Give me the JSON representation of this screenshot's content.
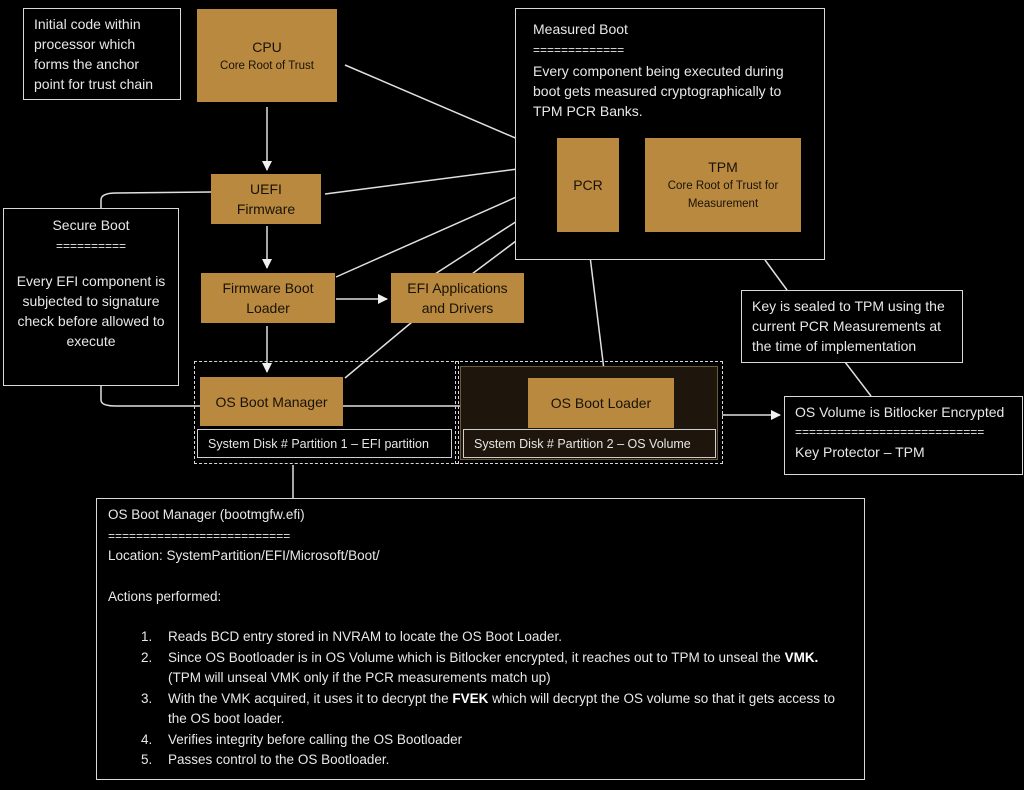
{
  "notes": {
    "cpu_note": "Initial code within processor which forms the anchor point for trust chain",
    "secure_boot": {
      "title": "Secure Boot",
      "rule": "==========",
      "body": "Every EFI component is subjected to signature check before allowed to execute"
    },
    "measured_boot": {
      "title": "Measured Boot",
      "rule": "=============",
      "body": "Every component being executed during boot gets measured cryptographically to TPM PCR Banks."
    },
    "key_sealed": "Key is sealed to TPM using the current PCR Measurements at the time of implementation",
    "bitlocker": {
      "title": "OS Volume is Bitlocker Encrypted",
      "rule": "===========================",
      "body": "Key Protector – TPM"
    }
  },
  "nodes": {
    "cpu": {
      "title": "CPU",
      "sub": "Core Root of Trust"
    },
    "uefi": {
      "line1": "UEFI",
      "line2": "Firmware"
    },
    "fw_boot_loader": {
      "line1": "Firmware Boot",
      "line2": "Loader"
    },
    "efi_apps": {
      "line1": "EFI Applications",
      "line2": "and Drivers"
    },
    "os_boot_manager": "OS Boot Manager",
    "os_boot_loader": "OS Boot Loader",
    "pcr": "PCR",
    "tpm": {
      "title": "TPM",
      "sub1": "Core Root of  Trust for",
      "sub2": "Measurement"
    }
  },
  "partitions": {
    "p1": "System Disk # Partition 1 – EFI partition",
    "p2": "System Disk # Partition 2 – OS Volume"
  },
  "boot_manager_detail": {
    "title": "OS Boot Manager (bootmgfw.efi)",
    "rule": "==========================",
    "location": "Location: SystemPartition/EFI/Microsoft/Boot/",
    "actions_heading": "Actions performed:",
    "actions": [
      {
        "pre": "Reads BCD entry stored in NVRAM to locate the OS Boot Loader.",
        "bold": "",
        "post": ""
      },
      {
        "pre": "Since OS Bootloader is in OS Volume which is Bitlocker encrypted, it reaches out to TPM to unseal the ",
        "bold": "VMK.",
        "post": " (TPM will unseal VMK only if the PCR measurements match up)"
      },
      {
        "pre": "With the VMK acquired, it uses it to decrypt the ",
        "bold": "FVEK",
        "post": " which will decrypt the OS volume so that it gets access to the OS boot loader."
      },
      {
        "pre": "Verifies integrity before calling the OS Bootloader",
        "bold": "",
        "post": ""
      },
      {
        "pre": "Passes control to the OS Bootloader.",
        "bold": "",
        "post": ""
      }
    ]
  },
  "colors": {
    "gold": "#b8893f",
    "background": "#000000",
    "line": "#d9d9d9",
    "dark_partition": "#1e160c"
  }
}
